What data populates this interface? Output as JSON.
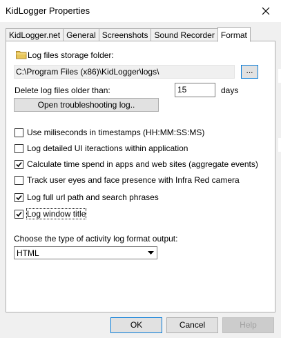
{
  "window": {
    "title": "KidLogger Properties"
  },
  "tabs": [
    {
      "label": "KidLogger.net"
    },
    {
      "label": "General"
    },
    {
      "label": "Screenshots"
    },
    {
      "label": "Sound Recorder"
    },
    {
      "label": "Format"
    }
  ],
  "active_tab": "Format",
  "storage": {
    "label": "Log files storage folder:",
    "path": "C:\\Program Files (x86)\\KidLogger\\logs\\",
    "browse_label": "..."
  },
  "delete_logs": {
    "label": "Delete log files older than:",
    "value": "15",
    "unit": "days"
  },
  "troubleshoot_button": "Open troubleshooting log..",
  "options": [
    {
      "label": "Use miliseconds in timestamps (HH:MM:SS:MS)",
      "checked": false
    },
    {
      "label": "Log detailed UI iteractions within application",
      "checked": false
    },
    {
      "label": "Calculate time spend in apps and web sites (aggregate events)",
      "checked": true
    },
    {
      "label": "Track user eyes and face presence with Infra Red camera",
      "checked": false
    },
    {
      "label": "Log full url path and search phrases",
      "checked": true
    },
    {
      "label": "Log window title",
      "checked": true
    }
  ],
  "format": {
    "label": "Choose the type of activity log format output:",
    "selected": "HTML"
  },
  "footer": {
    "ok": "OK",
    "cancel": "Cancel",
    "help": "Help"
  },
  "colors": {
    "accent": "#0078d7",
    "dialog_bg": "#f0f0f0",
    "panel_bg": "#ffffff"
  }
}
